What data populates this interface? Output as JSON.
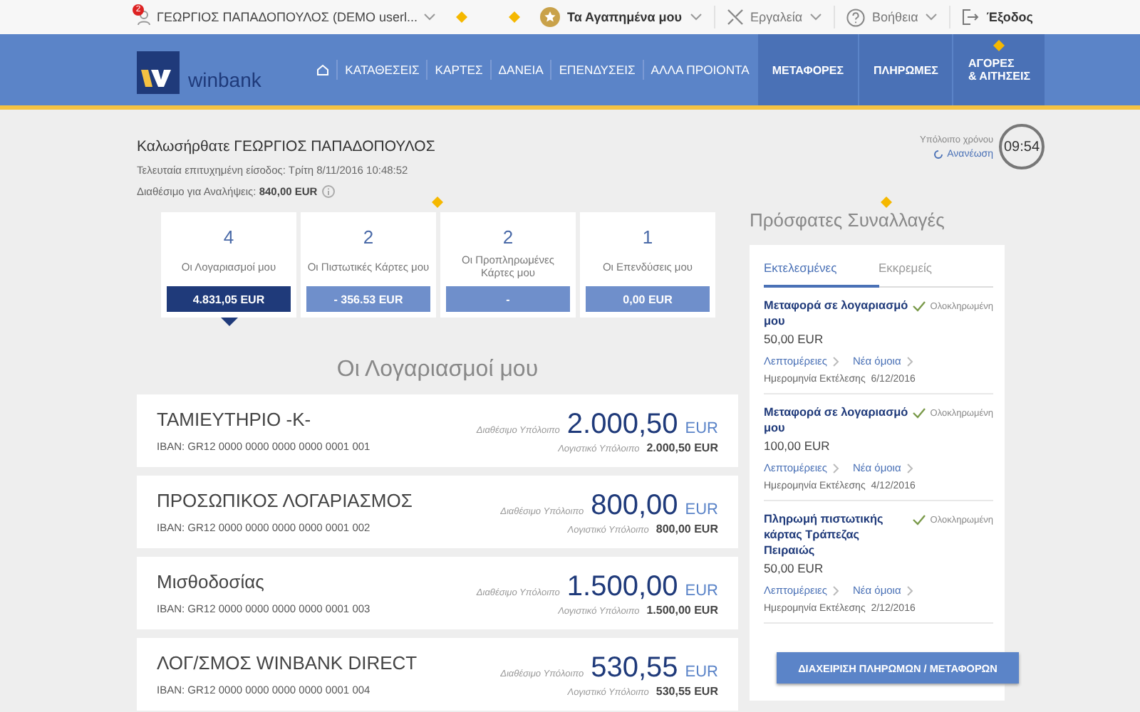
{
  "top_bar": {
    "user": {
      "name": "ΓΕΩΡΓΙΟΣ ΠΑΠΑΔΟΠΟΥΛΟΣ (DEMO userl...",
      "badge": "2"
    },
    "items": [
      {
        "kind": "favorites",
        "label": "Τα Αγαπημένα μου"
      },
      {
        "kind": "tools",
        "label": "Εργαλεία"
      },
      {
        "kind": "help",
        "label": "Βοήθεια"
      },
      {
        "kind": "logout",
        "label": "Έξοδος"
      }
    ]
  },
  "nav": {
    "logo": "winbank",
    "items": [
      {
        "kind": "home"
      },
      {
        "kind": "link",
        "label": "ΚΑΤΑΘΕΣΕΙΣ"
      },
      {
        "kind": "link",
        "label": "ΚΑΡΤΕΣ"
      },
      {
        "kind": "link",
        "label": "ΔΑΝΕΙΑ"
      },
      {
        "kind": "link",
        "label": "ΕΠΕΝΔΥΣΕΙΣ"
      },
      {
        "kind": "link",
        "label": "ΑΛΛΑ ΠΡΟΙΟΝΤΑ"
      },
      {
        "kind": "action",
        "label": "ΜΕΤΑΦΟΡΕΣ"
      },
      {
        "kind": "action",
        "label": "ΠΛΗΡΩΜΕΣ"
      },
      {
        "kind": "action",
        "label": "ΑΓΟΡΕΣ\n& ΑΙΤΗΣΕΙΣ"
      }
    ]
  },
  "welcome": {
    "title": "Καλωσήρθατε ΓΕΩΡΓΙΟΣ ΠΑΠΑΔΟΠΟΥΛΟΣ",
    "last_login": "Τελευταία επιτυχημένη είσοδος: Τρίτη 8/11/2016 10:48:52",
    "available": "Διαθέσιμο για Αναλήψεις:",
    "available_amount": "840,00 EUR"
  },
  "session": {
    "label": "Υπόλοιπο χρόνου",
    "refresh": "Ανανέωση",
    "time": "09:54"
  },
  "summary": [
    {
      "count": "4",
      "label": "Οι Λογαριασμοί μου",
      "amount": "4.831,05 EUR",
      "selected": true
    },
    {
      "count": "2",
      "label": "Οι Πιστωτικές Κάρτες μου",
      "amount": "- 356.53 EUR",
      "selected": false
    },
    {
      "count": "2",
      "label": "Οι Προπληρωμένες Κάρτες μου",
      "amount": "-",
      "selected": false
    },
    {
      "count": "1",
      "label": "Οι Επενδύσεις μου",
      "amount": "0,00 EUR",
      "selected": false
    }
  ],
  "accounts": {
    "title": "Οι Λογαριασμοί μου",
    "rows": [
      {
        "name": "ΤΑΜΙΕΥΤΗΡΙΟ -Κ-",
        "iban": "IBAN: GR12 0000 0000 0000 0000 0001 001",
        "available_label": "Διαθέσιμο Υπόλοιπο",
        "available": "2.000,50",
        "currency": "EUR",
        "ledger_label": "Λογιστικό Υπόλοιπο",
        "ledger": "2.000,50 EUR"
      },
      {
        "name": "ΠΡΟΣΩΠΙΚΟΣ ΛΟΓΑΡΙΑΣΜΟΣ",
        "iban": "IBAN: GR12 0000 0000 0000 0000 0001 002",
        "available_label": "Διαθέσιμο Υπόλοιπο",
        "available": "800,00",
        "currency": "EUR",
        "ledger_label": "Λογιστικό Υπόλοιπο",
        "ledger": "800,00 EUR"
      },
      {
        "name": "Μισθοδοσίας",
        "iban": "IBAN: GR12 0000 0000 0000 0000 0001 003",
        "available_label": "Διαθέσιμο Υπόλοιπο",
        "available": "1.500,00",
        "currency": "EUR",
        "ledger_label": "Λογιστικό Υπόλοιπο",
        "ledger": "1.500,00 EUR"
      },
      {
        "name": "ΛΟΓ/ΣΜΟΣ WINBANK DIRECT",
        "iban": "IBAN: GR12 0000 0000 0000 0000 0001 004",
        "available_label": "Διαθέσιμο Υπόλοιπο",
        "available": "530,55",
        "currency": "EUR",
        "ledger_label": "Λογιστικό Υπόλοιπο",
        "ledger": "530,55 EUR"
      }
    ]
  },
  "recent": {
    "title": "Πρόσφατες Συναλλαγές",
    "tabs": [
      {
        "label": "Εκτελεσμένες",
        "selected": true
      },
      {
        "label": "Εκκρεμείς",
        "selected": false
      }
    ],
    "items": [
      {
        "title": "Μεταφορά σε λογαριασμό μου",
        "status": "Ολοκληρωμένη",
        "amount": "50,00 EUR",
        "details": "Λεπτομέρειες",
        "repeat": "Νέα όμοια",
        "date_label": "Ημερομηνία Εκτέλεσης",
        "date": "6/12/2016"
      },
      {
        "title": "Μεταφορά σε λογαριασμό μου",
        "status": "Ολοκληρωμένη",
        "amount": "100,00 EUR",
        "details": "Λεπτομέρειες",
        "repeat": "Νέα όμοια",
        "date_label": "Ημερομηνία Εκτέλεσης",
        "date": "4/12/2016"
      },
      {
        "title": "Πληρωμή πιστωτικής κάρτας Τράπεζας Πειραιώς",
        "status": "Ολοκληρωμένη",
        "amount": "50,00 EUR",
        "details": "Λεπτομέρειες",
        "repeat": "Νέα όμοια",
        "date_label": "Ημερομηνία Εκτέλεσης",
        "date": "2/12/2016"
      }
    ],
    "button": "ΔΙΑΧΕΙΡΙΣΗ ΠΛΗΡΩΜΩΝ / ΜΕΤΑΦΟΡΩΝ"
  }
}
